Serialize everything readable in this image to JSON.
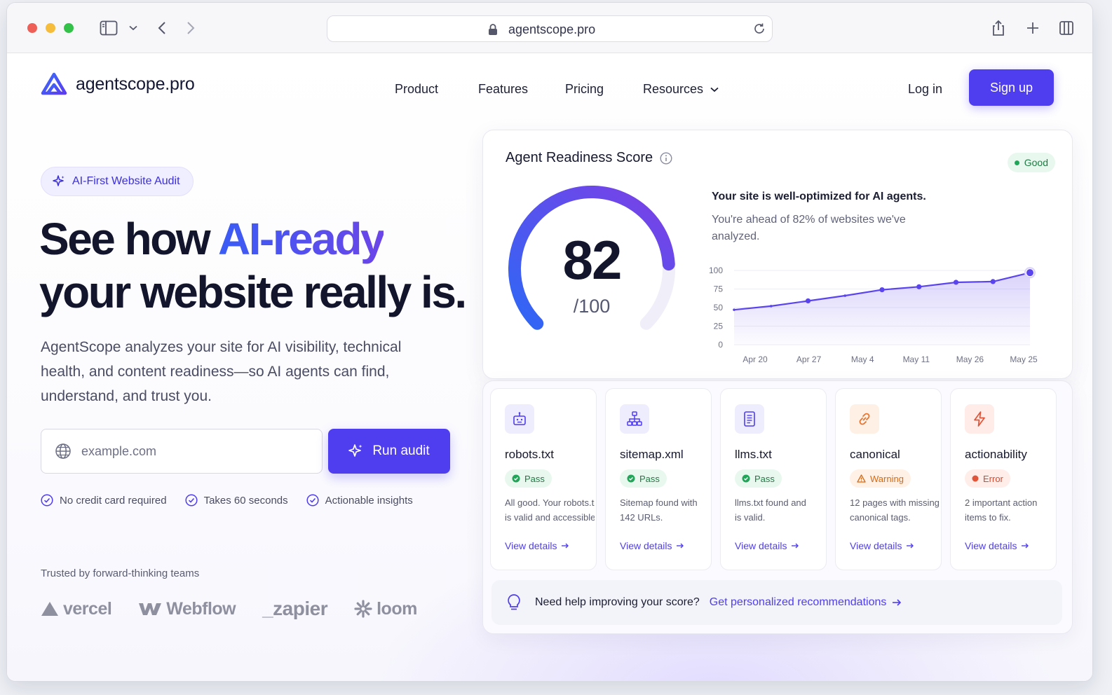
{
  "browser": {
    "url": "agentscope.pro"
  },
  "header": {
    "brand": "agentscope.pro",
    "nav": [
      "Product",
      "Features",
      "Pricing",
      "Resources"
    ],
    "login": "Log in",
    "signup": "Sign up"
  },
  "hero": {
    "pill": "AI-First Website Audit",
    "title_line1_prefix": "See how ",
    "title_line1_accent": "AI-ready",
    "title_line2": "your website really is.",
    "subtitle": "AgentScope analyzes your site for AI visibility, technical health, and content readiness—so AI agents can find, understand, and trust you.",
    "input_placeholder": "example.com",
    "run_button": "Run audit",
    "checks": [
      "No credit card required",
      "Takes 60 seconds",
      "Actionable insights"
    ],
    "trusted_label": "Trusted by forward-thinking teams",
    "brands": [
      "vercel",
      "Webflow",
      "_zapier",
      "loom"
    ]
  },
  "score": {
    "title": "Agent Readiness Score",
    "badge": "Good",
    "value": "82",
    "max": "/100",
    "fraction": 0.82,
    "headline": "Your site is well-optimized for AI agents.",
    "description": "You're ahead of 82% of websites we've analyzed.",
    "colors": {
      "accent": "#4f3df0",
      "good": "#22a559"
    }
  },
  "chart_data": {
    "type": "line",
    "x": [
      "Apr 20",
      "Apr 27",
      "May 4",
      "May 11",
      "May 26",
      "May 25"
    ],
    "xticks": [
      "Apr 20",
      "Apr 27",
      "May 4",
      "May 11",
      "May 26",
      "May 25"
    ],
    "y": [
      47,
      52,
      59,
      66,
      74,
      78,
      84,
      85,
      97
    ],
    "ylim": [
      0,
      100
    ],
    "yticks": [
      0,
      25,
      50,
      75,
      100
    ],
    "grid": true
  },
  "checks": [
    {
      "name": "robots.txt",
      "status": "Pass",
      "kind": "pass",
      "icon": "robot-icon",
      "desc1": "All good. Your robots.txt",
      "desc2": "is valid and accessible.",
      "link": "View details"
    },
    {
      "name": "sitemap.xml",
      "status": "Pass",
      "kind": "pass",
      "icon": "sitemap-icon",
      "desc1": "Sitemap found with",
      "desc2": "142 URLs.",
      "link": "View details"
    },
    {
      "name": "llms.txt",
      "status": "Pass",
      "kind": "pass",
      "icon": "document-icon",
      "desc1": "llms.txt found and",
      "desc2": "is valid.",
      "link": "View details"
    },
    {
      "name": "canonical",
      "status": "Warning",
      "kind": "warn",
      "icon": "link-icon",
      "desc1": "12 pages with missing",
      "desc2": "canonical tags.",
      "link": "View details"
    },
    {
      "name": "actionability",
      "status": "Error",
      "kind": "err",
      "icon": "lightning-icon",
      "desc1": "2 important action",
      "desc2": "items to fix.",
      "link": "View details"
    }
  ],
  "help": {
    "question": "Need help improving your score?",
    "link": "Get personalized recommendations"
  }
}
